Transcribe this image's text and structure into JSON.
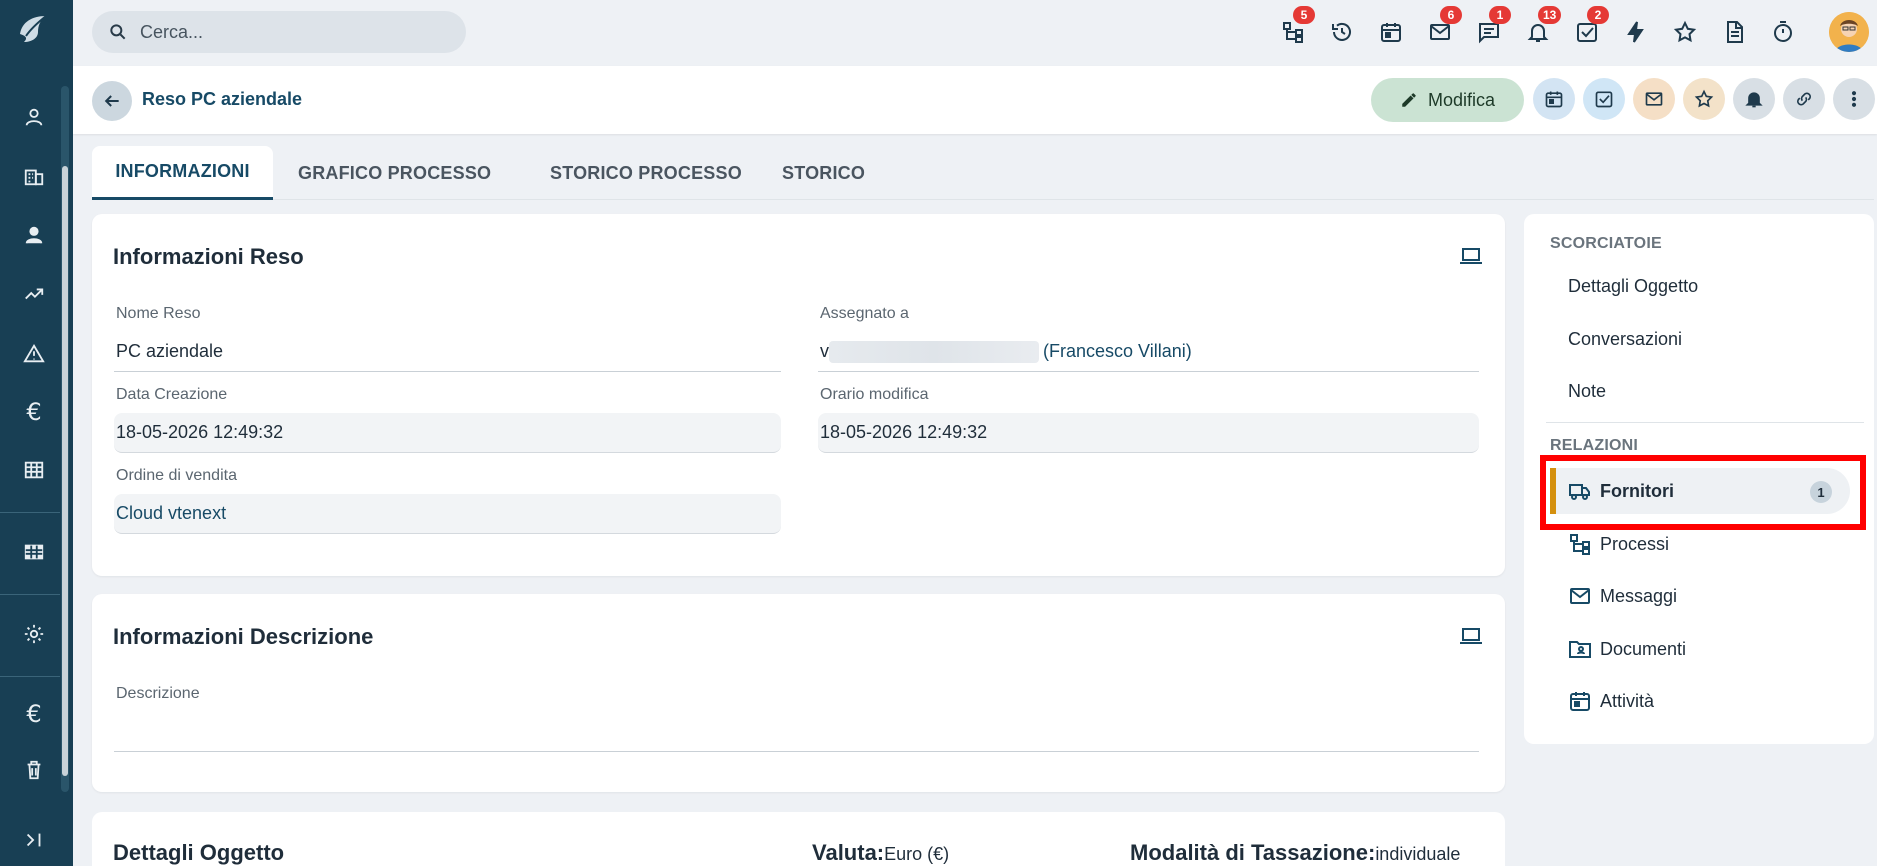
{
  "search": {
    "placeholder": "Cerca..."
  },
  "topbar": {
    "badges": {
      "processes": "5",
      "mail": "6",
      "chat": "1",
      "notifications": "13",
      "tasks": "2"
    }
  },
  "record": {
    "title": "Reso PC aziendale",
    "edit_label": "Modifica"
  },
  "tabs": [
    {
      "label": "INFORMAZIONI"
    },
    {
      "label": "GRAFICO PROCESSO"
    },
    {
      "label": "STORICO PROCESSO"
    },
    {
      "label": "STORICO"
    }
  ],
  "info_card": {
    "title": "Informazioni Reso",
    "fields": {
      "name_label": "Nome Reso",
      "name_value": "PC aziendale",
      "assigned_label": "Assegnato a",
      "assigned_prefix": "v",
      "assigned_value": "(Francesco Villani)",
      "created_label": "Data Creazione",
      "created_value": "18-05-2026 12:49:32",
      "modified_label": "Orario modifica",
      "modified_value": "18-05-2026 12:49:32",
      "order_label": "Ordine di vendita",
      "order_value": "Cloud vtenext"
    }
  },
  "desc_card": {
    "title": "Informazioni Descrizione",
    "desc_label": "Descrizione",
    "desc_value": ""
  },
  "details_card": {
    "title": "Dettagli Oggetto",
    "currency_label": "Valuta:",
    "currency_value": "Euro (€)",
    "tax_label": "Modalità di Tassazione:",
    "tax_value": "individuale"
  },
  "sidebar": {
    "shortcuts_title": "SCORCIATOIE",
    "shortcuts": [
      "Dettagli Oggetto",
      "Conversazioni",
      "Note"
    ],
    "relations_title": "RELAZIONI",
    "relations": [
      {
        "label": "Fornitori",
        "count": "1"
      },
      {
        "label": "Processi"
      },
      {
        "label": "Messaggi"
      },
      {
        "label": "Documenti"
      },
      {
        "label": "Attività"
      }
    ]
  },
  "colors": {
    "rail": "#183f54",
    "accent": "#174a66",
    "active_marker": "#d4900e",
    "highlight": "#ff0000"
  }
}
